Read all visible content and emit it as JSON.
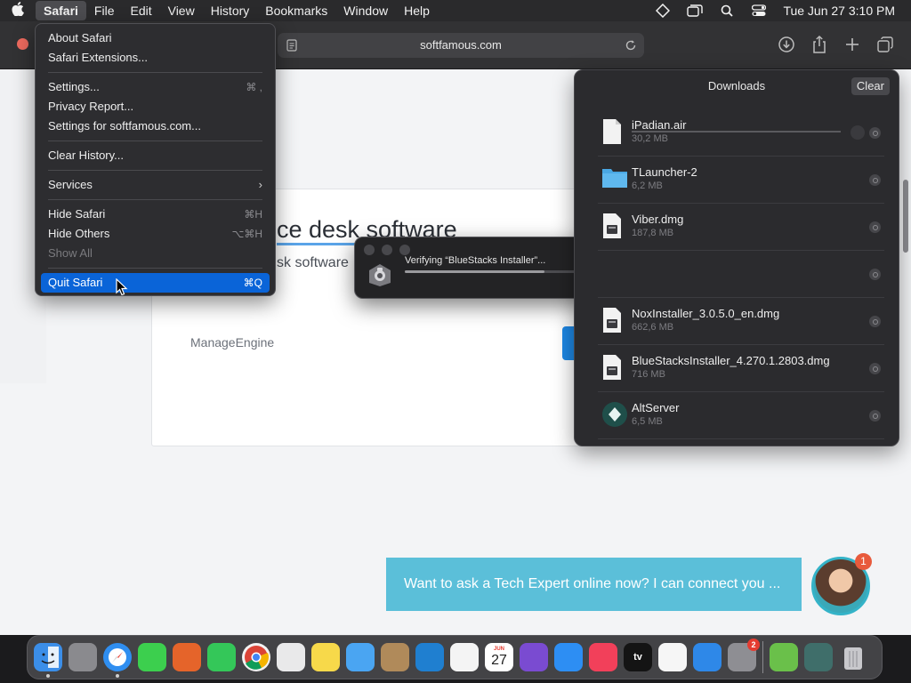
{
  "menubar": {
    "app_name": "Safari",
    "items": [
      "File",
      "Edit",
      "View",
      "History",
      "Bookmarks",
      "Window",
      "Help"
    ],
    "clock": "Tue Jun 27  3:10 PM",
    "status_icons": [
      "diamond-icon",
      "display-icon",
      "search-icon",
      "control-center-icon"
    ]
  },
  "toolbar": {
    "url": "softfamous.com"
  },
  "safari_menu": {
    "items": [
      {
        "label": "About Safari",
        "shortcut": ""
      },
      {
        "label": "Safari Extensions...",
        "shortcut": ""
      },
      {
        "label": "Settings...",
        "shortcut": "⌘ ,"
      },
      {
        "label": "Privacy Report...",
        "shortcut": ""
      },
      {
        "label": "Settings for softfamous.com...",
        "shortcut": ""
      },
      {
        "label": "Clear History...",
        "shortcut": ""
      },
      {
        "label": "Services",
        "shortcut": ""
      },
      {
        "label": "Hide Safari",
        "shortcut": "⌘H"
      },
      {
        "label": "Hide Others",
        "shortcut": "⌥⌘H"
      },
      {
        "label": "Show All",
        "shortcut": ""
      },
      {
        "label": "Quit Safari",
        "shortcut": "⌘Q"
      }
    ]
  },
  "webpage": {
    "headline": "ce desk software",
    "subline": "sk software",
    "brand": "ManageEngine",
    "chat_prompt": "Want to ask a Tech Expert online now? I can connect you ...",
    "chat_badge": "1"
  },
  "verify_dialog": {
    "text": "Verifying “BlueStacks Installer”...",
    "progress": 0.5
  },
  "downloads": {
    "title": "Downloads",
    "clear_label": "Clear",
    "items": [
      {
        "name": "iPadian.air",
        "size": "30,2 MB",
        "icon": "document-icon",
        "in_progress": true
      },
      {
        "name": "TLauncher-2",
        "size": "6,2 MB",
        "icon": "folder-icon",
        "in_progress": false
      },
      {
        "name": "Viber.dmg",
        "size": "187,8 MB",
        "icon": "disk-image-icon",
        "in_progress": false
      },
      {
        "name": "",
        "size": "",
        "icon": "",
        "in_progress": false
      },
      {
        "name": "NoxInstaller_3.0.5.0_en.dmg",
        "size": "662,6 MB",
        "icon": "disk-image-icon",
        "in_progress": false
      },
      {
        "name": "BlueStacksInstaller_4.270.1.2803.dmg",
        "size": "716 MB",
        "icon": "disk-image-icon",
        "in_progress": false
      },
      {
        "name": "AltServer",
        "size": "6,5 MB",
        "icon": "altserver-icon",
        "in_progress": false
      }
    ]
  },
  "dock": {
    "apps": [
      {
        "name": "finder",
        "color": "#3b8ee8",
        "running": true
      },
      {
        "name": "launchpad",
        "color": "#8a8a8e",
        "running": false
      },
      {
        "name": "safari",
        "color": "#2f8ef0",
        "running": true
      },
      {
        "name": "messages",
        "color": "#3ccf4e",
        "running": false
      },
      {
        "name": "firefox",
        "color": "#e5642a",
        "running": false
      },
      {
        "name": "facetime",
        "color": "#34c759",
        "running": false
      },
      {
        "name": "chrome",
        "color": "#f2f2f2",
        "running": false
      },
      {
        "name": "textedit",
        "color": "#e9e9ea",
        "running": false
      },
      {
        "name": "notes",
        "color": "#f7d94a",
        "running": false
      },
      {
        "name": "mail",
        "color": "#4aa5f2",
        "running": false
      },
      {
        "name": "contacts",
        "color": "#b08a5a",
        "running": false
      },
      {
        "name": "vscode",
        "color": "#1f7fd0",
        "running": false
      },
      {
        "name": "reminders",
        "color": "#f4f4f4",
        "running": false
      },
      {
        "name": "calendar",
        "color": "#ffffff",
        "running": false
      },
      {
        "name": "visual-studio",
        "color": "#7a4bd1",
        "running": false
      },
      {
        "name": "app-store",
        "color": "#2d8ef3",
        "running": false
      },
      {
        "name": "music",
        "color": "#f2405a",
        "running": false
      },
      {
        "name": "apple-tv",
        "color": "#141414",
        "running": false
      },
      {
        "name": "news",
        "color": "#f6f6f6",
        "running": false
      },
      {
        "name": "keynote",
        "color": "#2e88e8",
        "running": false
      },
      {
        "name": "system-settings",
        "color": "#8e8e93",
        "running": false
      },
      {
        "name": "bluestacks",
        "color": "#6ac04a",
        "running": false
      },
      {
        "name": "altserver",
        "color": "#3f6e6a",
        "running": false
      },
      {
        "name": "trash",
        "color": "#9a9a9e",
        "running": false
      }
    ],
    "calendar_month": "JUN",
    "calendar_day": "27",
    "settings_badge": "2",
    "tv_label": "tv"
  }
}
